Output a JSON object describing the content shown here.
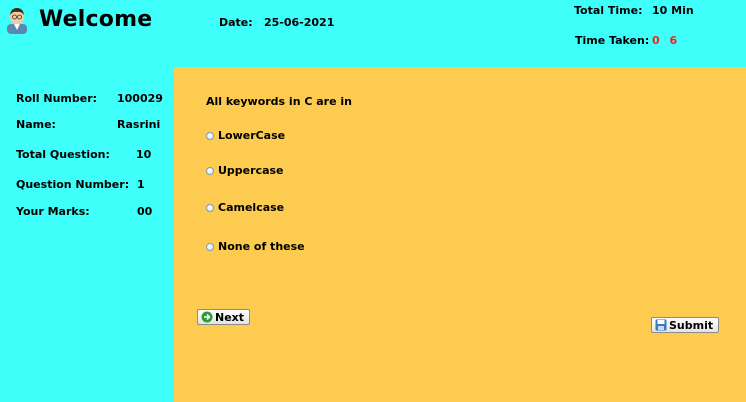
{
  "header": {
    "title": "Welcome",
    "date_label": "Date:",
    "date_value": "25-06-2021",
    "total_time_label": "Total Time:",
    "total_time_value": "10 Min",
    "time_taken_label": "Time Taken:",
    "time_taken_value": "0 6"
  },
  "sidebar": {
    "roll_label": "Roll Number:",
    "roll_value": "100029",
    "name_label": "Name:",
    "name_value": "Rasrini",
    "total_q_label": "Total Question:",
    "total_q_value": "10",
    "q_num_label": "Question Number:",
    "q_num_value": "1",
    "marks_label": "Your Marks:",
    "marks_value": "00"
  },
  "quiz": {
    "question": "All keywords in C are in",
    "options": [
      "LowerCase",
      "Uppercase",
      "Camelcase",
      "None of these"
    ],
    "next_label": "Next",
    "submit_label": "Submit"
  },
  "icons": {
    "avatar": "student-avatar-icon",
    "next": "arrow-right-circle-icon",
    "submit": "floppy-disk-icon"
  },
  "colors": {
    "header_bg": "#3ffffa",
    "main_bg": "#fccb4f",
    "time_taken": "#e8261e"
  }
}
